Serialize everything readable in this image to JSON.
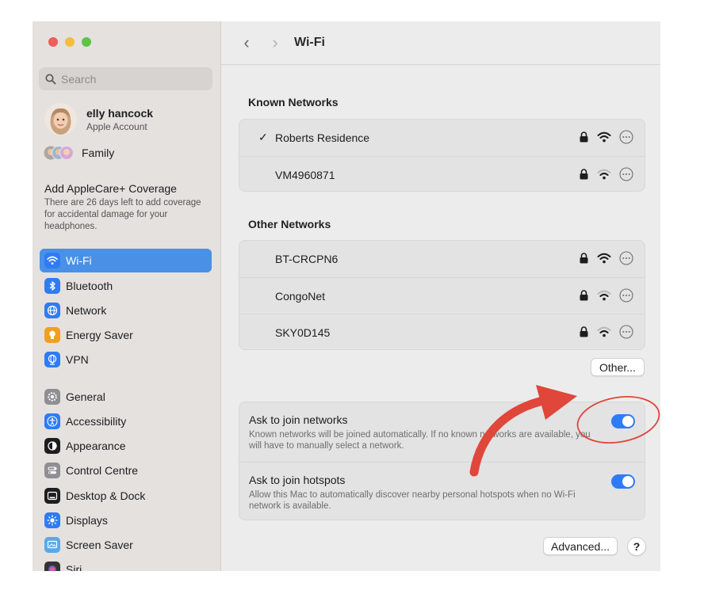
{
  "window": {
    "title": "Wi-Fi"
  },
  "search": {
    "placeholder": "Search"
  },
  "account": {
    "name": "elly hancock",
    "subtitle": "Apple Account"
  },
  "family": {
    "label": "Family"
  },
  "applecare": {
    "title": "Add AppleCare+ Coverage",
    "description": "There are 26 days left to add coverage for accidental damage for your headphones."
  },
  "sidebar": {
    "items": [
      {
        "label": "Wi-Fi",
        "icon": "wifi-icon",
        "color": "#2f7bf5",
        "selected": true
      },
      {
        "label": "Bluetooth",
        "icon": "bluetooth-icon",
        "color": "#2f7bf5"
      },
      {
        "label": "Network",
        "icon": "globe-icon",
        "color": "#2f7bf5"
      },
      {
        "label": "Energy Saver",
        "icon": "lightbulb-icon",
        "color": "#f0a020"
      },
      {
        "label": "VPN",
        "icon": "vpn-globe-icon",
        "color": "#2f7bf5"
      },
      {
        "label": "General",
        "icon": "gear-icon",
        "color": "#8e8e93"
      },
      {
        "label": "Accessibility",
        "icon": "accessibility-icon",
        "color": "#2f7bf5"
      },
      {
        "label": "Appearance",
        "icon": "appearance-icon",
        "color": "#1d1d1f"
      },
      {
        "label": "Control Centre",
        "icon": "control-centre-icon",
        "color": "#8e8e93"
      },
      {
        "label": "Desktop & Dock",
        "icon": "dock-icon",
        "color": "#1d1d1f"
      },
      {
        "label": "Displays",
        "icon": "sun-icon",
        "color": "#2f7bf5"
      },
      {
        "label": "Screen Saver",
        "icon": "screen-saver-icon",
        "color": "#5aa9e6"
      },
      {
        "label": "Siri",
        "icon": "siri-icon",
        "color": "#333333"
      }
    ]
  },
  "known_networks": {
    "heading": "Known Networks",
    "items": [
      {
        "name": "Roberts Residence",
        "connected": true,
        "checkmark": "✓",
        "signal": "strong"
      },
      {
        "name": "VM4960871",
        "connected": false,
        "signal": "medium"
      }
    ]
  },
  "other_networks": {
    "heading": "Other Networks",
    "items": [
      {
        "name": "BT-CRCPN6",
        "signal": "strong"
      },
      {
        "name": "CongoNet",
        "signal": "medium"
      },
      {
        "name": "SKY0D145",
        "signal": "medium"
      }
    ]
  },
  "buttons": {
    "other": "Other...",
    "advanced": "Advanced...",
    "help": "?"
  },
  "toggles": [
    {
      "title": "Ask to join networks",
      "description": "Known networks will be joined automatically. If no known networks are available, you will have to manually select a network.",
      "on": true
    },
    {
      "title": "Ask to join hotspots",
      "description": "Allow this Mac to automatically discover nearby personal hotspots when no Wi-Fi network is available.",
      "on": true
    }
  ],
  "colors": {
    "accent": "#2f7bf5",
    "annotation": "#e0463a"
  }
}
